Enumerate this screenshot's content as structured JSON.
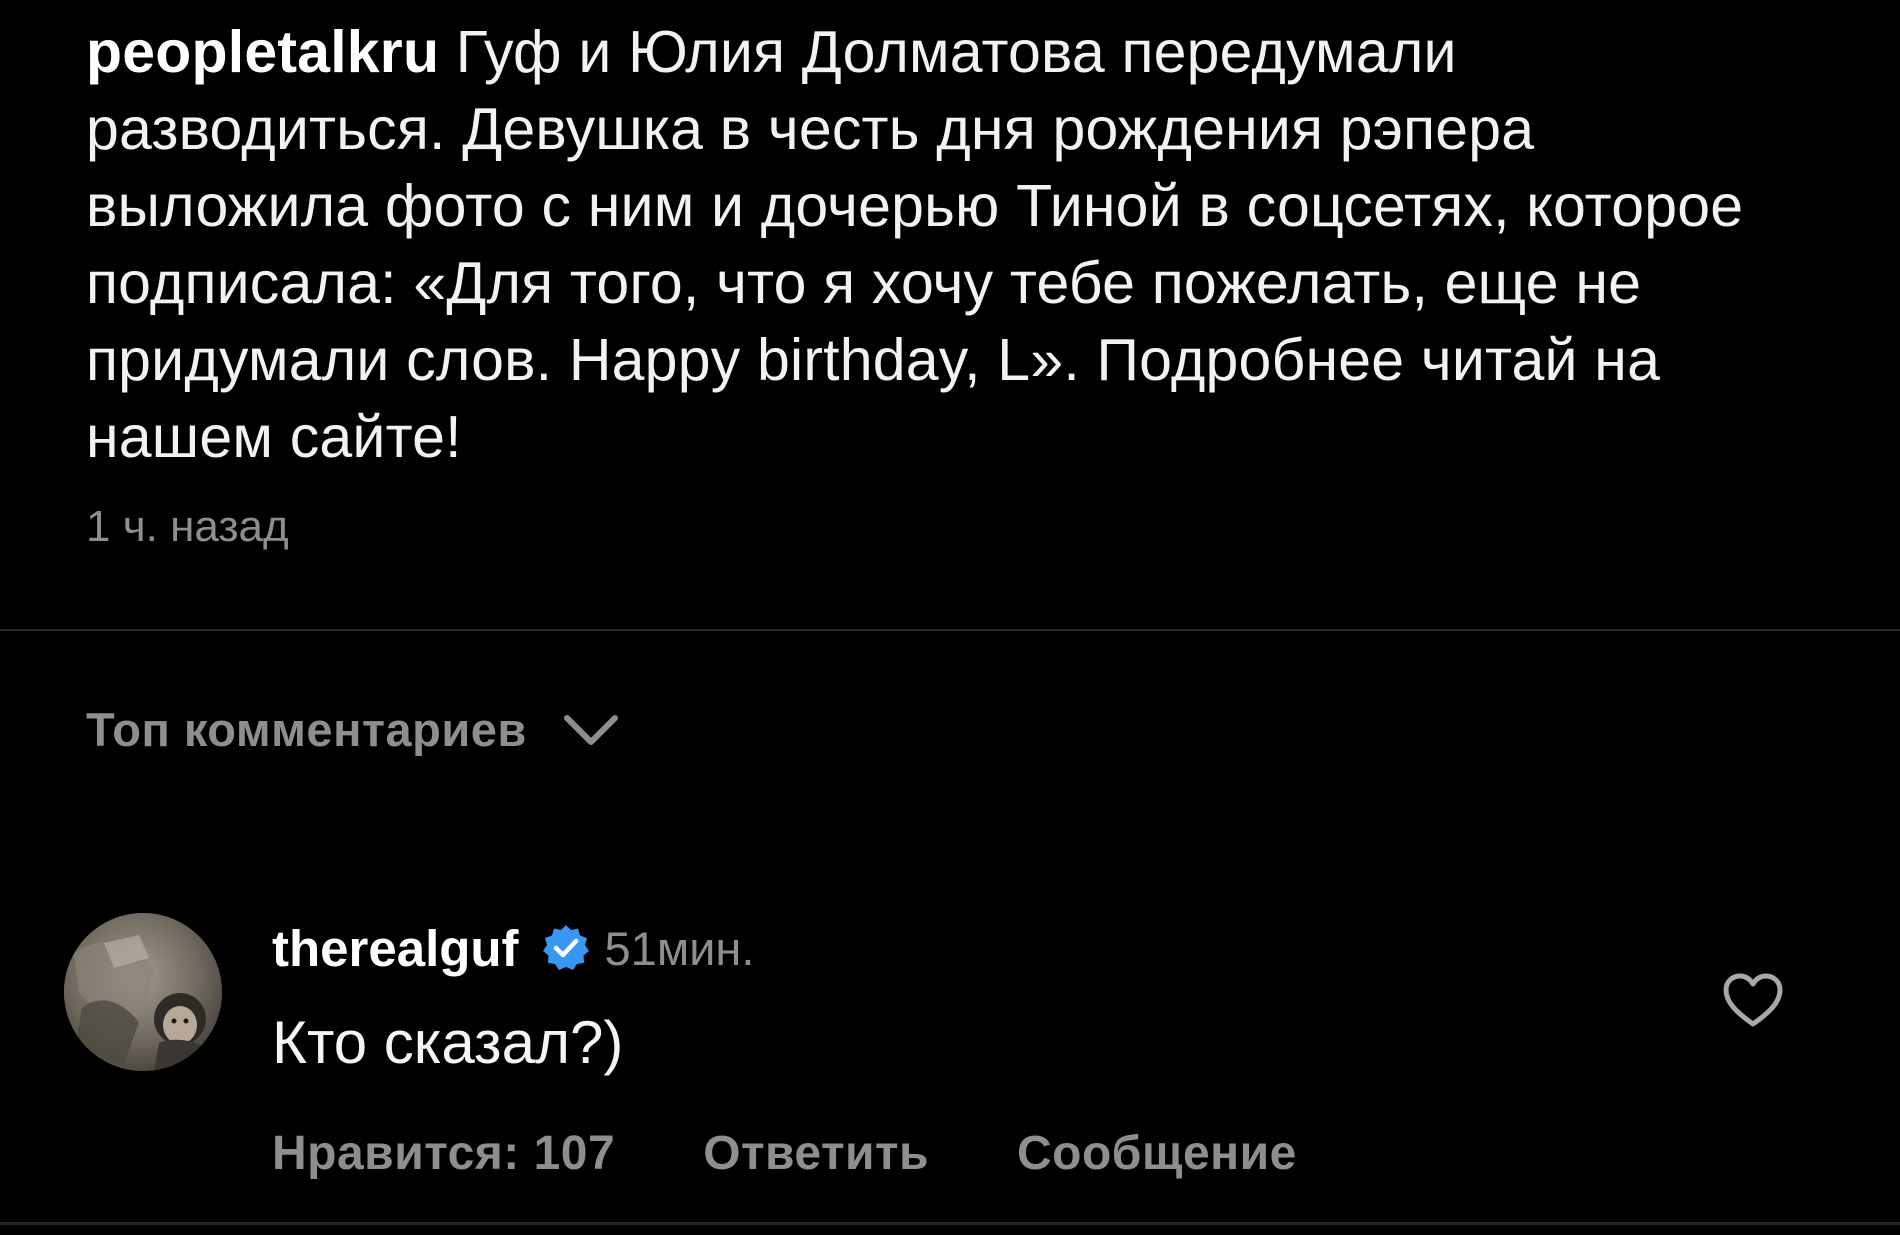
{
  "post": {
    "username": "peopletalkru",
    "caption": "Гуф и Юлия Долматова передумали разводиться. Девушка в честь дня рождения рэпера выложила фото с ним и дочерью Тиной в соцсетях, которое подписала: «Для того, что я хочу тебе пожелать, еще не придумали слов. Happy birthday, L». Подробнее читай на нашем сайте!",
    "time": "1 ч. назад"
  },
  "comments_section": {
    "sort_label": "Топ комментариев",
    "sort_icon": "chevron-down-icon"
  },
  "comment": {
    "username": "therealguf",
    "verified_icon": "verified-badge-icon",
    "time": "51мин.",
    "text": "Кто сказал?)",
    "likes_label": "Нравится: 107",
    "reply_label": "Ответить",
    "message_label": "Сообщение",
    "like_icon": "heart-icon"
  },
  "colors": {
    "background": "#000000",
    "primary_text": "#f5f5f5",
    "secondary_text": "#8e8e8e",
    "verified_blue": "#3897f0"
  }
}
